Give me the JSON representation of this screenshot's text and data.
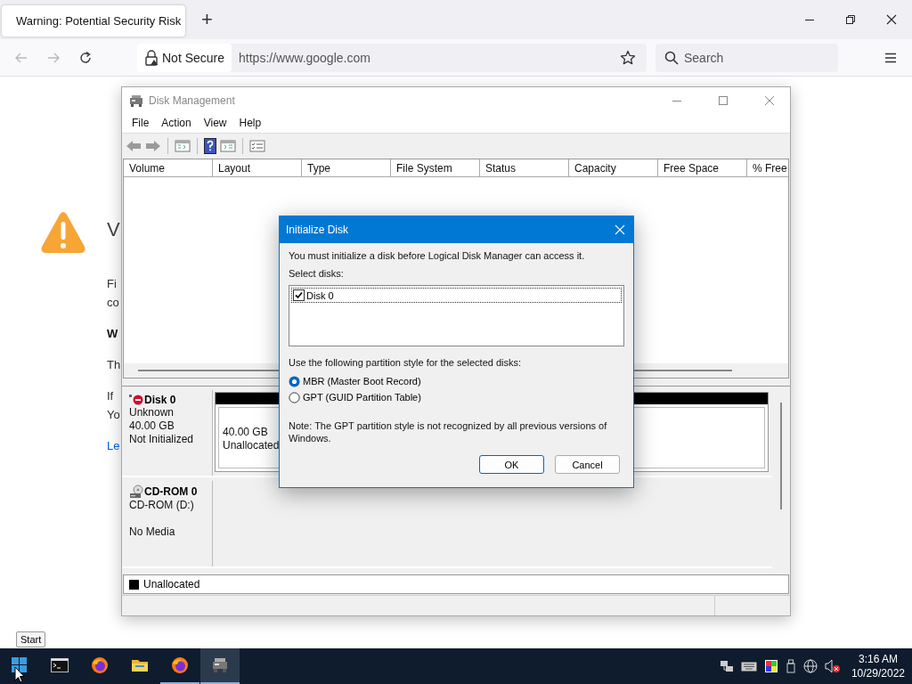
{
  "browser": {
    "tab": {
      "title": "Warning: Potential Security Risk"
    },
    "new_tab": "+",
    "address": {
      "security": "Not Secure",
      "url": "https://www.google.com"
    },
    "search": {
      "placeholder": "Search"
    }
  },
  "page": {
    "paragraphs": [
      {
        "kind": "heading",
        "lines": [
          "V"
        ]
      },
      {
        "kind": "body",
        "lines": [
          "Fi",
          "co"
        ]
      },
      {
        "kind": "subheading",
        "lines": [
          "W"
        ]
      },
      {
        "kind": "body",
        "lines": [
          "Th"
        ]
      },
      {
        "kind": "body",
        "lines": [
          "If",
          "Yo"
        ]
      },
      {
        "kind": "link",
        "lines": [
          "Le"
        ]
      }
    ]
  },
  "disk_management": {
    "title": "Disk Management",
    "menu": [
      "File",
      "Action",
      "View",
      "Help"
    ],
    "columns": [
      "Volume",
      "Layout",
      "Type",
      "File System",
      "Status",
      "Capacity",
      "Free Space",
      "% Free"
    ],
    "disks": [
      {
        "kind": "disk",
        "name": "Disk 0",
        "type": "Unknown",
        "size": "40.00 GB",
        "status": "Not Initialized",
        "partition": {
          "size": "40.00 GB",
          "label": "Unallocated"
        }
      },
      {
        "kind": "cdrom",
        "name": "CD-ROM 0",
        "type": "CD-ROM (D:)",
        "status": "No Media"
      }
    ],
    "legend": [
      {
        "label": "Unallocated",
        "color": "#000000"
      }
    ]
  },
  "dialog": {
    "title": "Initialize Disk",
    "message": "You must initialize a disk before Logical Disk Manager can access it.",
    "select_label": "Select disks:",
    "disks": [
      {
        "label": "Disk 0",
        "checked": true,
        "selected": true
      }
    ],
    "style_label": "Use the following partition style for the selected disks:",
    "styles": [
      {
        "label": "MBR (Master Boot Record)",
        "selected": true
      },
      {
        "label": "GPT (GUID Partition Table)",
        "selected": false
      }
    ],
    "note": "Note: The GPT partition style is not recognized by all previous versions of Windows.",
    "buttons": [
      {
        "label": "OK",
        "default": true
      },
      {
        "label": "Cancel",
        "default": false
      }
    ]
  },
  "taskbar": {
    "tooltip": "Start",
    "apps": [
      {
        "kind": "start",
        "running": false,
        "selected": false
      },
      {
        "kind": "terminal",
        "running": false,
        "selected": false
      },
      {
        "kind": "firefox",
        "running": false,
        "selected": false
      },
      {
        "kind": "folder",
        "running": false,
        "selected": false
      },
      {
        "kind": "firefox",
        "running": true,
        "selected": false
      },
      {
        "kind": "diskmgmt",
        "running": true,
        "selected": true
      }
    ],
    "clock": {
      "time": "3:16 AM",
      "date": "10/29/2022"
    }
  }
}
